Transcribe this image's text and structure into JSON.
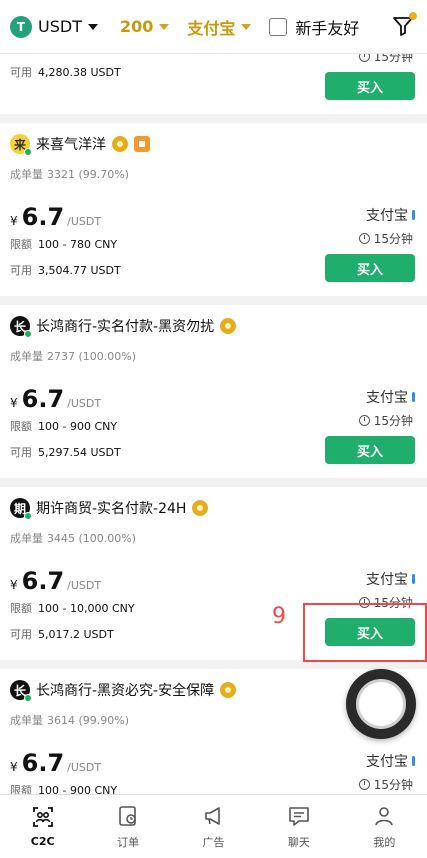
{
  "topbar": {
    "coin": "USDT",
    "amount": "200",
    "payment": "支付宝",
    "newbie_label": "新手友好"
  },
  "partial_card": {
    "time_limit": "15分钟",
    "available_label": "可用",
    "available": "4,280.38 USDT",
    "buy_label": "买入"
  },
  "cards": [
    {
      "avatar_char": "来",
      "avatar_style": "yellow",
      "name": "来喜气洋洋",
      "badges": [
        "gold-badge",
        "orange-badge"
      ],
      "stats_label": "成单量",
      "stats": "3321 (99.70%)",
      "currency_symbol": "¥",
      "price": "6.7",
      "unit": "/USDT",
      "limit_label": "限额",
      "limit": "100 - 780 CNY",
      "available_label": "可用",
      "available": "3,504.77 USDT",
      "payment": "支付宝",
      "time_limit": "15分钟",
      "buy_label": "买入"
    },
    {
      "avatar_char": "长",
      "avatar_style": "black",
      "name": "长鸿商行-实名付款-黑资勿扰",
      "badges": [
        "gold-badge"
      ],
      "stats_label": "成单量",
      "stats": "2737 (100.00%)",
      "currency_symbol": "¥",
      "price": "6.7",
      "unit": "/USDT",
      "limit_label": "限额",
      "limit": "100 - 900 CNY",
      "available_label": "可用",
      "available": "5,297.54 USDT",
      "payment": "支付宝",
      "time_limit": "15分钟",
      "buy_label": "买入"
    },
    {
      "avatar_char": "期",
      "avatar_style": "black",
      "name": "期许商贸-实名付款-24H",
      "badges": [
        "gold-badge"
      ],
      "stats_label": "成单量",
      "stats": "3445 (100.00%)",
      "currency_symbol": "¥",
      "price": "6.7",
      "unit": "/USDT",
      "limit_label": "限额",
      "limit": "100 - 10,000 CNY",
      "available_label": "可用",
      "available": "5,017.2 USDT",
      "payment": "支付宝",
      "time_limit": "15分钟",
      "buy_label": "买入"
    },
    {
      "avatar_char": "长",
      "avatar_style": "black",
      "name": "长鸿商行-黑资必究-安全保障",
      "badges": [
        "gold-badge"
      ],
      "stats_label": "成单量",
      "stats": "3614 (99.90%)",
      "currency_symbol": "¥",
      "price": "6.7",
      "unit": "/USDT",
      "limit_label": "限额",
      "limit": "100 - 900 CNY",
      "payment": "支付宝",
      "time_limit": "15分钟"
    }
  ],
  "annotation": {
    "number": "9",
    "color": "#ea4a4a"
  },
  "bottom_nav": [
    {
      "label": "C2C",
      "icon": "c2c-icon",
      "active": true
    },
    {
      "label": "订单",
      "icon": "orders-icon",
      "active": false
    },
    {
      "label": "广告",
      "icon": "megaphone-icon",
      "active": false
    },
    {
      "label": "聊天",
      "icon": "chat-icon",
      "active": false
    },
    {
      "label": "我的",
      "icon": "profile-icon",
      "active": false
    }
  ],
  "colors": {
    "buy_green": "#1fae6b",
    "gold": "#c9980d",
    "usdt_green": "#26a17b"
  }
}
